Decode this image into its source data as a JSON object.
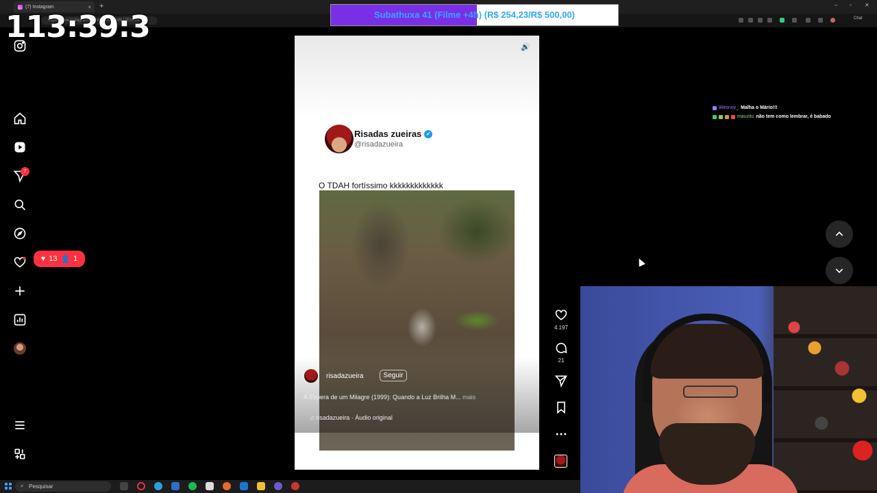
{
  "browser": {
    "tab_title": "(7) Instagram",
    "tab_close": "×",
    "new_tab": "+",
    "url": "https://www.instagram.com/reels/DTLhNUZEXXm/",
    "window_controls": [
      "–",
      "▫",
      "✕"
    ],
    "extension_label": "Chat"
  },
  "overlay": {
    "timer": "113:39:3",
    "subathon_text": "Subathuxa 41 (Filme +4h) (R$ 254,23/R$ 500,00)",
    "subathon_progress": 0.5085,
    "subathon_fill_color": "#7b2ee8",
    "subathon_text_color": "#2ea9ff"
  },
  "sidebar": {
    "items": [
      {
        "name": "instagram-logo-icon"
      },
      {
        "name": "home-icon"
      },
      {
        "name": "reels-icon"
      },
      {
        "name": "messages-icon",
        "badge": "7"
      },
      {
        "name": "search-icon"
      },
      {
        "name": "explore-icon"
      },
      {
        "name": "notifications-icon"
      },
      {
        "name": "create-icon"
      },
      {
        "name": "dashboard-icon"
      },
      {
        "name": "profile-icon"
      },
      {
        "name": "more-menu-icon"
      },
      {
        "name": "threads-icon"
      }
    ],
    "notif_badge": "7",
    "notif_pill": {
      "likes": "13",
      "follows": "1"
    }
  },
  "reel": {
    "post_name": "Risadas zueiras",
    "post_handle": "@risadazueira",
    "caption": "O TDAH fortíssimo kkkkkkkkkkkkk",
    "author": "risadazueira",
    "follow_label": "Seguir",
    "description": "À Espera de um Milagre (1999): Quando a Luz Brilha M...",
    "more_label": "mais",
    "audio": "risadazueira · Áudio original",
    "likes": "4.197",
    "comments": "21"
  },
  "chat": [
    {
      "user": "Wesnoy_",
      "message": "Malha o Mário!!!",
      "user_color": "#a970ff"
    },
    {
      "user": "mauzitu",
      "message": "não tem como lembrar, é babado",
      "user_color": "#7ddc88"
    }
  ],
  "taskbar": {
    "search_placeholder": "Pesquisar"
  }
}
